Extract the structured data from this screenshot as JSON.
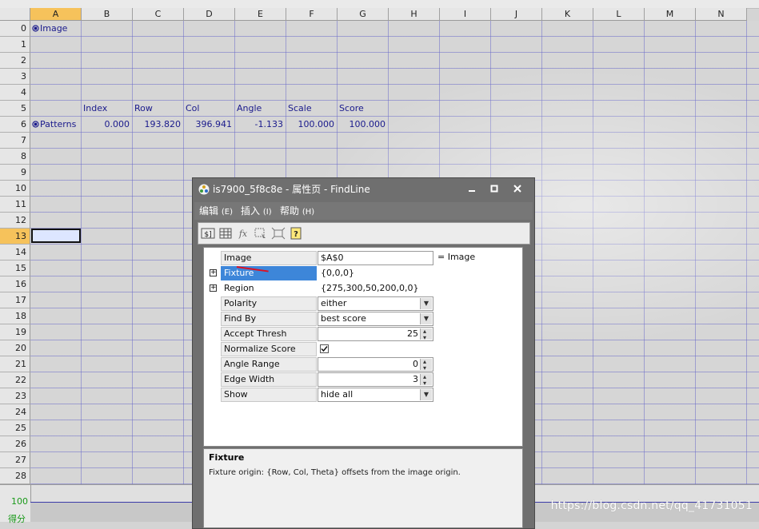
{
  "columns": [
    "A",
    "B",
    "C",
    "D",
    "E",
    "F",
    "G",
    "H",
    "I",
    "J",
    "K",
    "L",
    "M",
    "N"
  ],
  "selected_column": "A",
  "rows": [
    "0",
    "1",
    "2",
    "3",
    "4",
    "5",
    "6",
    "7",
    "8",
    "9",
    "10",
    "11",
    "12",
    "13",
    "14",
    "15",
    "16",
    "17",
    "18",
    "19",
    "20",
    "21",
    "22",
    "23",
    "24",
    "25",
    "26",
    "27",
    "28"
  ],
  "selected_row": "13",
  "cells": {
    "a0": "Image",
    "b5": "Index",
    "c5": "Row",
    "d5": "Col",
    "e5": "Angle",
    "f5": "Scale",
    "g5": "Score",
    "a6": "Patterns",
    "b6": "0.000",
    "c6": "193.820",
    "d6": "396.941",
    "e6": "-1.133",
    "f6": "100.000",
    "g6": "100.000"
  },
  "bottom_pane": {
    "value": "100",
    "label": "得分"
  },
  "watermark": "https://blog.csdn.net/qq_41731051",
  "dialog": {
    "title": "is7900_5f8c8e - 属性页 - FindLine",
    "menus": [
      {
        "label": "编辑",
        "key": "(E)"
      },
      {
        "label": "插入",
        "key": "(I)"
      },
      {
        "label": "帮助",
        "key": "(H)"
      }
    ],
    "properties": {
      "image": {
        "label": "Image",
        "value": "$A$0",
        "note": "= Image"
      },
      "fixture": {
        "label": "Fixture",
        "value": "{0,0,0}"
      },
      "region": {
        "label": "Region",
        "value": "{275,300,50,200,0,0}"
      },
      "polarity": {
        "label": "Polarity",
        "value": "either"
      },
      "find_by": {
        "label": "Find By",
        "value": "best score"
      },
      "accept_thresh": {
        "label": "Accept Thresh",
        "value": "25"
      },
      "normalize_score": {
        "label": "Normalize Score",
        "checked": true
      },
      "angle_range": {
        "label": "Angle Range",
        "value": "0"
      },
      "edge_width": {
        "label": "Edge Width",
        "value": "3"
      },
      "show": {
        "label": "Show",
        "value": "hide all"
      }
    },
    "description": {
      "title": "Fixture",
      "text": "Fixture origin: {Row, Col, Theta} offsets from the image origin."
    }
  }
}
